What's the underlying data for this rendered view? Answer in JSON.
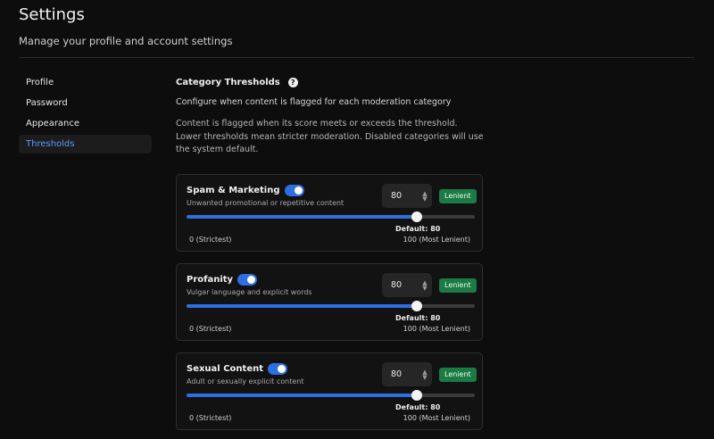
{
  "header": {
    "title": "Settings",
    "subtitle": "Manage your profile and account settings"
  },
  "sidebar": {
    "items": [
      {
        "label": "Profile",
        "active": false
      },
      {
        "label": "Password",
        "active": false
      },
      {
        "label": "Appearance",
        "active": false
      },
      {
        "label": "Thresholds",
        "active": true
      }
    ]
  },
  "section": {
    "title": "Category Thresholds",
    "help_icon": "question-circle-icon",
    "description": "Configure when content is flagged for each moderation category",
    "info": "Content is flagged when its score meets or exceeds the threshold. Lower thresholds mean stricter moderation. Disabled categories will use the system default."
  },
  "categories": [
    {
      "name": "Spam & Marketing",
      "enabled": true,
      "description": "Unwanted promotional or repetitive content",
      "value": "80",
      "badge": "Lenient",
      "default_label": "Default: 80",
      "min_label": "0 (Strictest)",
      "max_label": "100 (Most Lenient)",
      "slider_value": 80,
      "slider_max": 100
    },
    {
      "name": "Profanity",
      "enabled": true,
      "description": "Vulgar language and explicit words",
      "value": "80",
      "badge": "Lenient",
      "default_label": "Default: 80",
      "min_label": "0 (Strictest)",
      "max_label": "100 (Most Lenient)",
      "slider_value": 80,
      "slider_max": 100
    },
    {
      "name": "Sexual Content",
      "enabled": true,
      "description": "Adult or sexually explicit content",
      "value": "80",
      "badge": "Lenient",
      "default_label": "Default: 80",
      "min_label": "0 (Strictest)",
      "max_label": "100 (Most Lenient)",
      "slider_value": 80,
      "slider_max": 100
    }
  ],
  "colors": {
    "accent": "#2d6fe0",
    "active_nav": "#5a9cff",
    "badge_bg": "#1c7a45"
  }
}
